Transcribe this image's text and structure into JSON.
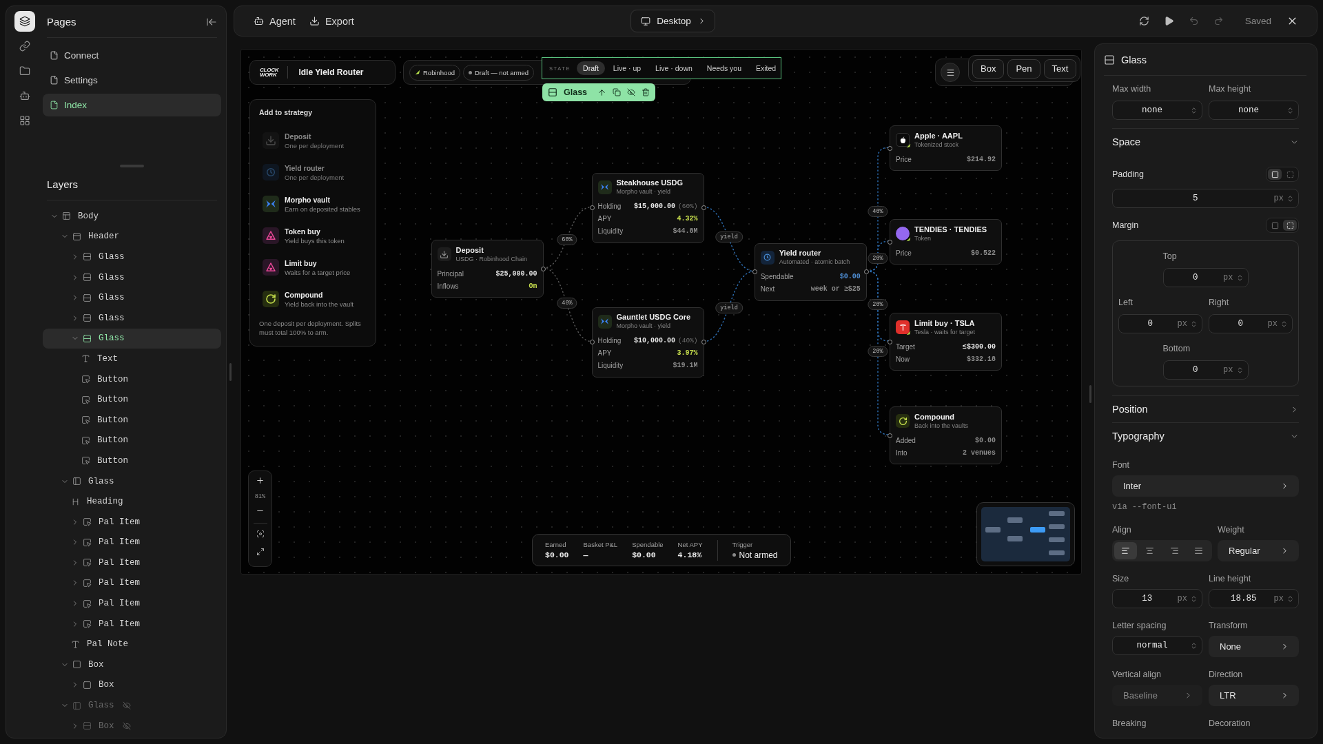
{
  "sidebar": {
    "rail": [
      {
        "kind": "layers",
        "selected": true
      },
      {
        "kind": "links",
        "selected": false
      },
      {
        "kind": "files",
        "selected": false
      },
      {
        "kind": "agent",
        "selected": false
      },
      {
        "kind": "components",
        "selected": false
      }
    ],
    "pages": {
      "title": "Pages",
      "items": [
        {
          "label": "Connect",
          "selected": false
        },
        {
          "label": "Settings",
          "selected": false
        },
        {
          "label": "Index",
          "selected": true
        }
      ]
    },
    "layers": {
      "title": "Layers",
      "tree": [
        {
          "label": "Body",
          "kind": "body",
          "expanded": true,
          "selected": false,
          "hidden": false,
          "children": [
            {
              "label": "Header",
              "kind": "header",
              "expanded": true,
              "selected": false,
              "hidden": false,
              "children": [
                {
                  "label": "Glass",
                  "kind": "stack",
                  "expanded": false,
                  "selected": false,
                  "hidden": false
                },
                {
                  "label": "Glass",
                  "kind": "stack",
                  "expanded": false,
                  "selected": false,
                  "hidden": false
                },
                {
                  "label": "Glass",
                  "kind": "stack",
                  "expanded": false,
                  "selected": false,
                  "hidden": false
                },
                {
                  "label": "Glass",
                  "kind": "stack",
                  "expanded": false,
                  "selected": false,
                  "hidden": false
                },
                {
                  "label": "Glass",
                  "kind": "stack",
                  "expanded": true,
                  "selected": true,
                  "hidden": false,
                  "children": [
                    {
                      "label": "Text",
                      "kind": "text",
                      "selected": false,
                      "hidden": false
                    },
                    {
                      "label": "Button",
                      "kind": "button",
                      "selected": false,
                      "hidden": false
                    },
                    {
                      "label": "Button",
                      "kind": "button",
                      "selected": false,
                      "hidden": false
                    },
                    {
                      "label": "Button",
                      "kind": "button",
                      "selected": false,
                      "hidden": false
                    },
                    {
                      "label": "Button",
                      "kind": "button",
                      "selected": false,
                      "hidden": false
                    },
                    {
                      "label": "Button",
                      "kind": "button",
                      "selected": false,
                      "hidden": false
                    }
                  ]
                }
              ]
            },
            {
              "label": "Glass",
              "kind": "panel",
              "expanded": true,
              "selected": false,
              "hidden": false,
              "children": [
                {
                  "label": "Heading",
                  "kind": "heading",
                  "selected": false,
                  "hidden": false
                },
                {
                  "label": "Pal Item",
                  "kind": "button",
                  "expanded": false,
                  "selected": false,
                  "hidden": false
                },
                {
                  "label": "Pal Item",
                  "kind": "button",
                  "expanded": false,
                  "selected": false,
                  "hidden": false
                },
                {
                  "label": "Pal Item",
                  "kind": "button",
                  "expanded": false,
                  "selected": false,
                  "hidden": false
                },
                {
                  "label": "Pal Item",
                  "kind": "button",
                  "expanded": false,
                  "selected": false,
                  "hidden": false
                },
                {
                  "label": "Pal Item",
                  "kind": "button",
                  "expanded": false,
                  "selected": false,
                  "hidden": false
                },
                {
                  "label": "Pal Item",
                  "kind": "button",
                  "expanded": false,
                  "selected": false,
                  "hidden": false
                },
                {
                  "label": "Pal Note",
                  "kind": "text",
                  "selected": false,
                  "hidden": false
                }
              ]
            },
            {
              "label": "Box",
              "kind": "box",
              "expanded": true,
              "selected": false,
              "hidden": false,
              "children": [
                {
                  "label": "Box",
                  "kind": "box",
                  "expanded": false,
                  "selected": false,
                  "hidden": false
                }
              ]
            },
            {
              "label": "Glass",
              "kind": "panel",
              "expanded": true,
              "selected": false,
              "hidden": true,
              "children": [
                {
                  "label": "Box",
                  "kind": "stack",
                  "expanded": false,
                  "selected": false,
                  "hidden": true
                }
              ]
            }
          ]
        }
      ]
    }
  },
  "toolbar": {
    "items": [
      {
        "kind": "agent",
        "label": "Agent"
      },
      {
        "kind": "export",
        "label": "Export"
      }
    ],
    "device": "Desktop",
    "actions": [
      {
        "kind": "refresh",
        "disabled": false
      },
      {
        "kind": "play",
        "disabled": false
      },
      {
        "kind": "undo",
        "disabled": true
      },
      {
        "kind": "redo",
        "disabled": true
      }
    ],
    "save_status": "Saved"
  },
  "canvas": {
    "brand": {
      "logo": [
        "CLOCK",
        "WORK"
      ],
      "title": "Idle Yield Router"
    },
    "chips": [
      {
        "kind": "network",
        "label": "Robinhood"
      },
      {
        "kind": "status",
        "label": "Draft — not armed"
      }
    ],
    "state_bar": {
      "label": "STATE",
      "tabs": [
        {
          "label": "Draft",
          "selected": true
        },
        {
          "label": "Live · up",
          "selected": false
        },
        {
          "label": "Live · down",
          "selected": false
        },
        {
          "label": "Needs you",
          "selected": false
        },
        {
          "label": "Exited",
          "selected": false
        }
      ]
    },
    "selection": {
      "label": "Glass"
    },
    "tools": [
      {
        "label": "Box"
      },
      {
        "label": "Pen"
      },
      {
        "label": "Text"
      }
    ],
    "palette": {
      "title": "Add to strategy",
      "items": [
        {
          "kind": "deposit",
          "title": "Deposit",
          "subtitle": "One per deployment",
          "disabled": true
        },
        {
          "kind": "router",
          "title": "Yield router",
          "subtitle": "One per deployment",
          "disabled": true
        },
        {
          "kind": "vault",
          "title": "Morpho vault",
          "subtitle": "Earn on deposited stables",
          "disabled": false
        },
        {
          "kind": "swap",
          "title": "Token buy",
          "subtitle": "Yield buys this token",
          "disabled": false
        },
        {
          "kind": "limit",
          "title": "Limit buy",
          "subtitle": "Waits for a target price",
          "disabled": false
        },
        {
          "kind": "compound",
          "title": "Compound",
          "subtitle": "Yield back into the vault",
          "disabled": false
        }
      ],
      "note": "One deposit per deployment. Splits must total 100% to arm."
    },
    "nodes": [
      {
        "kind": "deposit",
        "title": "Deposit",
        "subtitle": "USDG · Robinhood Chain",
        "highlighted": false,
        "rows": [
          {
            "label": "Principal",
            "value": "$25,000.00",
            "color": "#e8e8e8"
          },
          {
            "label": "Inflows",
            "value": "On",
            "color": "#c9e04e"
          }
        ]
      },
      {
        "kind": "vault",
        "title": "Steakhouse USDG",
        "subtitle": "Morpho vault · yield",
        "highlighted": false,
        "rows": [
          {
            "label": "Holding",
            "value": "$15,000.00",
            "share": "(60%)",
            "color": "#e8e8e8"
          },
          {
            "label": "APY",
            "value": "4.32%",
            "color": "#c9e04e"
          },
          {
            "label": "Liquidity",
            "value": "$44.8M",
            "color": "#8c8c8c"
          }
        ]
      },
      {
        "kind": "vault",
        "title": "Gauntlet USDG Core",
        "subtitle": "Morpho vault · yield",
        "highlighted": false,
        "rows": [
          {
            "label": "Holding",
            "value": "$10,000.00",
            "share": "(40%)",
            "color": "#e8e8e8"
          },
          {
            "label": "APY",
            "value": "3.97%",
            "color": "#c9e04e"
          },
          {
            "label": "Liquidity",
            "value": "$19.1M",
            "color": "#8c8c8c"
          }
        ]
      },
      {
        "kind": "router",
        "title": "Yield router",
        "subtitle": "Automated · atomic batch",
        "highlighted": true,
        "rows": [
          {
            "label": "Spendable",
            "value": "$0.00",
            "color": "#4f8fd6"
          },
          {
            "label": "Next",
            "value": "week or ≥$25",
            "color": "#8c8c8c"
          }
        ]
      },
      {
        "kind": "stock",
        "title": "Apple · AAPL",
        "subtitle": "Tokenized stock",
        "highlighted": false,
        "rows": [
          {
            "label": "Price",
            "value": "$214.92",
            "color": "#8c8c8c"
          }
        ]
      },
      {
        "kind": "token",
        "title": "TENDIES · TENDIES",
        "subtitle": "Token",
        "highlighted": false,
        "rows": [
          {
            "label": "Price",
            "value": "$0.522",
            "color": "#8c8c8c"
          }
        ]
      },
      {
        "kind": "limit",
        "title": "Limit buy · TSLA",
        "subtitle": "Tesla · waits for target",
        "highlighted": false,
        "rows": [
          {
            "label": "Target",
            "value": "≤$300.00",
            "color": "#e8e8e8"
          },
          {
            "label": "Now",
            "value": "$332.18",
            "color": "#8c8c8c"
          }
        ]
      },
      {
        "kind": "compound",
        "title": "Compound",
        "subtitle": "Back into the vaults",
        "highlighted": false,
        "rows": [
          {
            "label": "Added",
            "value": "$0.00",
            "color": "#8c8c8c"
          },
          {
            "label": "Into",
            "value": "2 venues",
            "color": "#8c8c8c"
          }
        ]
      }
    ],
    "edges": [
      {
        "label": "60%"
      },
      {
        "label": "40%"
      },
      {
        "label": "yield"
      },
      {
        "label": "yield"
      },
      {
        "label": "40%"
      },
      {
        "label": "20%"
      },
      {
        "label": "20%"
      },
      {
        "label": "20%"
      }
    ],
    "zoom": "81%",
    "stats": {
      "items": [
        {
          "label": "Earned",
          "value": "$0.00"
        },
        {
          "label": "Basket P&L",
          "value": "—"
        },
        {
          "label": "Spendable",
          "value": "$0.00"
        },
        {
          "label": "Net APY",
          "value": "4.18%"
        }
      ],
      "trigger": {
        "label": "Trigger",
        "value": "Not armed",
        "armed": false
      }
    }
  },
  "inspector": {
    "title": "Glass",
    "limits": [
      {
        "label": "Max width",
        "value": "none"
      },
      {
        "label": "Max height",
        "value": "none"
      }
    ],
    "space": {
      "title": "Space",
      "expanded": true,
      "padding": {
        "label": "Padding",
        "value": "5",
        "unit": "px",
        "modes": [
          {
            "kind": "all",
            "selected": true
          },
          {
            "kind": "sides",
            "selected": false
          }
        ]
      },
      "margin": {
        "label": "Margin",
        "modes": [
          {
            "kind": "all",
            "selected": false
          },
          {
            "kind": "sides",
            "selected": true
          }
        ],
        "sides": [
          {
            "label": "Top",
            "value": "0",
            "unit": "px"
          },
          {
            "label": "Left",
            "value": "0",
            "unit": "px"
          },
          {
            "label": "Right",
            "value": "0",
            "unit": "px"
          },
          {
            "label": "Bottom",
            "value": "0",
            "unit": "px"
          }
        ]
      }
    },
    "position": {
      "title": "Position",
      "expanded": false
    },
    "typography": {
      "title": "Typography",
      "expanded": true,
      "font": {
        "label": "Font",
        "value": "Inter",
        "hint": "via --font-ui"
      },
      "align": {
        "label": "Align",
        "options": [
          {
            "kind": "left",
            "selected": true
          },
          {
            "kind": "center",
            "selected": false
          },
          {
            "kind": "right",
            "selected": false
          },
          {
            "kind": "justify",
            "selected": false
          }
        ]
      },
      "weight": {
        "label": "Weight",
        "value": "Regular"
      },
      "fields": [
        {
          "kind": "number",
          "label": "Size",
          "value": "13",
          "unit": "px"
        },
        {
          "kind": "number",
          "label": "Line height",
          "value": "18.85",
          "unit": "px"
        },
        {
          "kind": "number",
          "label": "Letter spacing",
          "value": "normal"
        },
        {
          "kind": "select",
          "label": "Transform",
          "value": "None",
          "disabled": false
        },
        {
          "kind": "select",
          "label": "Vertical align",
          "value": "Baseline",
          "disabled": true
        },
        {
          "kind": "select",
          "label": "Direction",
          "value": "LTR",
          "disabled": false
        },
        {
          "kind": "label",
          "label": "Breaking"
        },
        {
          "kind": "label",
          "label": "Decoration"
        }
      ]
    }
  }
}
